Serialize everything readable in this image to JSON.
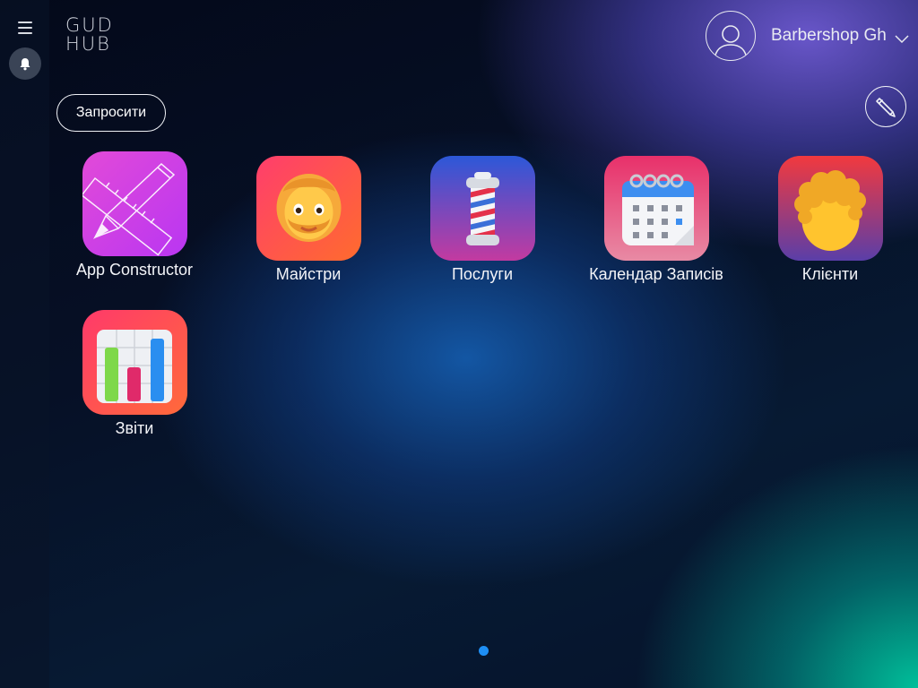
{
  "header": {
    "logo_line1": "GUD",
    "logo_line2": "HUB",
    "user_name": "Barbershop Gh"
  },
  "sidebar": {
    "menu_icon": "hamburger-icon",
    "notification_icon": "bell-icon"
  },
  "toolbar": {
    "invite_label": "Запросити",
    "edit_icon": "pencil-icon"
  },
  "apps": [
    {
      "label": "App Constructor",
      "icon": "pencil-ruler-icon"
    },
    {
      "label": "Майстри",
      "icon": "bearded-face-icon"
    },
    {
      "label": "Послуги",
      "icon": "barber-pole-icon"
    },
    {
      "label": "Календар Записів",
      "icon": "calendar-icon"
    },
    {
      "label": "Клієнти",
      "icon": "curly-hair-head-icon"
    },
    {
      "label": "Звіти",
      "icon": "bar-chart-icon"
    }
  ],
  "pagination": {
    "current_page": 1,
    "total_pages": 1
  },
  "colors": {
    "accent_dot": "#1e8ff5",
    "constructor_icon": "#c840e8",
    "reports_icon": "#f64a5a"
  }
}
